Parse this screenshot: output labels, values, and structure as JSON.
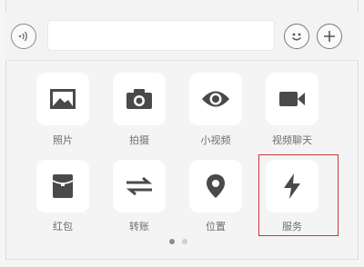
{
  "input_bar": {
    "voice_icon": "voice-wave-icon",
    "text_value": "",
    "emoji_icon": "smiley-icon",
    "plus_icon": "plus-icon"
  },
  "panel": {
    "items": [
      {
        "label": "照片",
        "icon": "photo-icon"
      },
      {
        "label": "拍摄",
        "icon": "camera-icon"
      },
      {
        "label": "小视频",
        "icon": "eye-icon"
      },
      {
        "label": "视频聊天",
        "icon": "video-camera-icon"
      },
      {
        "label": "红包",
        "icon": "red-packet-icon"
      },
      {
        "label": "转账",
        "icon": "transfer-arrows-icon"
      },
      {
        "label": "位置",
        "icon": "location-pin-icon"
      },
      {
        "label": "服务",
        "icon": "lightning-icon"
      }
    ],
    "page_indicator": {
      "pages": 2,
      "current": 1
    },
    "highlighted_item": "服务"
  },
  "colors": {
    "icon": "#4a4a4a",
    "highlight_border": "#c93636",
    "dot_active": "#8c8c8c",
    "dot_inactive": "#cfcfcf"
  }
}
